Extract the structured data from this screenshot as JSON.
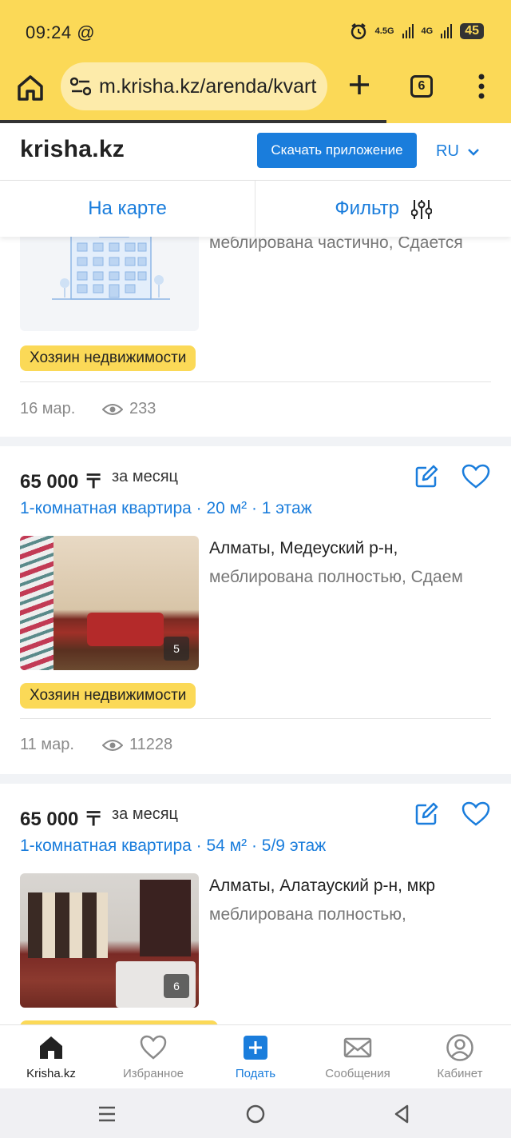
{
  "status": {
    "time": "09:24",
    "net1": "4.5G",
    "net2": "4G",
    "battery": "45"
  },
  "browser": {
    "url": "m.krisha.kz/arenda/kvart",
    "tabs_count": "6"
  },
  "header": {
    "logo": "krisha.kz",
    "download_app": "Скачать приложение",
    "lang": "RU"
  },
  "toolbar": {
    "map": "На карте",
    "filter": "Фильтр"
  },
  "listings": [
    {
      "desc": "меблирована частично, Сдается",
      "badge": "Хозяин недвижимости",
      "date": "16 мар.",
      "views": "233"
    },
    {
      "price": "65 000 〒",
      "per": "за месяц",
      "title": "1-комнатная квартира · 20 м² · 1 этаж",
      "address": "Алматы, Медеуский р-н,",
      "desc": "меблирована полностью, Сдаем",
      "photos": "5",
      "badge": "Хозяин недвижимости",
      "date": "11 мар.",
      "views": "11228"
    },
    {
      "price": "65 000 〒",
      "per": "за месяц",
      "title": "1-комнатная квартира · 54 м² · 5/9 этаж",
      "address": "Алматы, Алатауский р-н, мкр",
      "desc": "меблирована полностью,",
      "photos": "6"
    }
  ],
  "nav": {
    "home": "Krisha.kz",
    "favorites": "Избранное",
    "post": "Подать",
    "messages": "Сообщения",
    "cabinet": "Кабинет"
  },
  "colors": {
    "brand_yellow": "#fbd957",
    "accent_blue": "#1a7ddc"
  }
}
